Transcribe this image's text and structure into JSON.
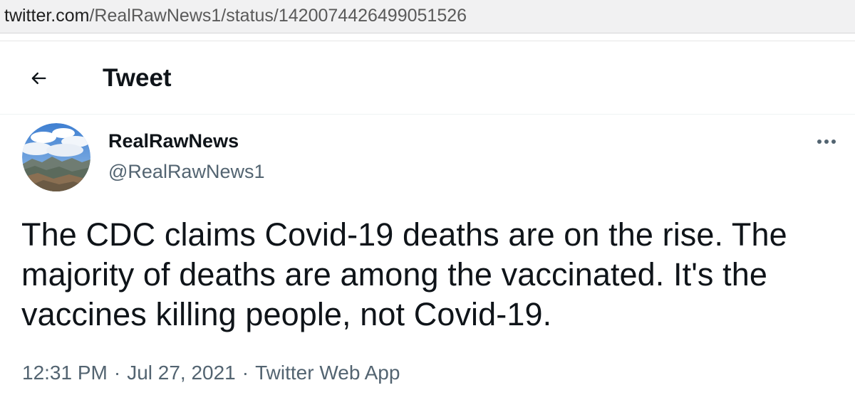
{
  "browser": {
    "url_host": "twitter.com",
    "url_path": "/RealRawNews1/status/1420074426499051526"
  },
  "header": {
    "back_icon": "arrow-left-icon",
    "title": "Tweet"
  },
  "tweet": {
    "author_name": "RealRawNews",
    "author_handle": "@RealRawNews1",
    "more_icon": "more-horizontal-icon",
    "text": "The CDC claims Covid-19 deaths are on the rise. The majority of deaths are among the vaccinated. It's the vaccines killing people, not Covid-19.",
    "time": "12:31 PM",
    "date": "Jul 27, 2021",
    "source": "Twitter Web App",
    "separator": "·"
  },
  "colors": {
    "text_primary": "#0f1419",
    "text_secondary": "#536471",
    "url_bar_bg": "#f1f1f2"
  }
}
